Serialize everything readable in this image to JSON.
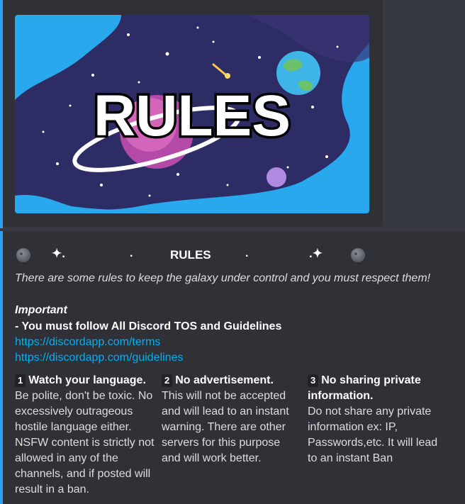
{
  "banner": {
    "title": "RULES"
  },
  "header": {
    "title": "RULES",
    "sparkle_left": "✦.",
    "dot1": ".",
    "dot2": ".",
    "sparkle_right": ".✦"
  },
  "intro": "There are some rules to keep the galaxy under control and you must respect them!",
  "important_label": "Important",
  "tos_line": "- You must follow All Discord TOS and Guidelines",
  "links": [
    "https://discordapp.com/terms",
    "https://discordapp.com/guidelines"
  ],
  "rules": [
    {
      "number": "1",
      "title": "Watch your language.",
      "body": "Be polite, don't be toxic. No excessively outrageous hostile language either. NSFW content is strictly not allowed in any of the channels, and if posted will result in a ban."
    },
    {
      "number": "2",
      "title": "No advertisement.",
      "body": "This will not be accepted and will lead to an instant warning. There are other servers for this purpose and will work better."
    },
    {
      "number": "3",
      "title": "No sharing private information.",
      "body": "Do not share any private information ex: IP, Passwords,etc. It will lead to an instant Ban"
    }
  ],
  "colors": {
    "accent": "#2f9ff0",
    "link": "#00b0f4",
    "embed_bg": "#2f3136",
    "page_bg": "#36393f"
  }
}
